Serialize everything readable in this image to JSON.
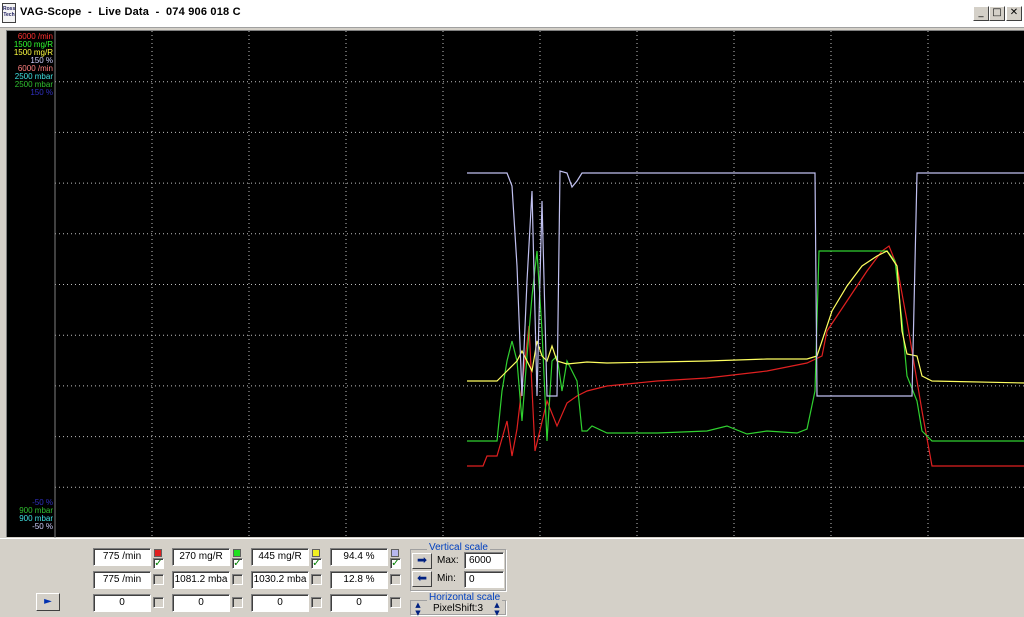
{
  "window": {
    "icon_text": "Ross Tech",
    "title": "VAG-Scope  -  Live Data  -  074 906 018 C",
    "minimize_glyph": "_",
    "maximize_glyph": "□",
    "close_glyph": "✕"
  },
  "scale_labels": {
    "top": [
      {
        "text": "6000 /min",
        "color": "#ff3030"
      },
      {
        "text": "1500 mg/R",
        "color": "#30ff30"
      },
      {
        "text": "1500 mg/R",
        "color": "#ffff40"
      },
      {
        "text": "150 %",
        "color": "#d0d0ff"
      },
      {
        "text": "6000 /min",
        "color": "#ff8080"
      },
      {
        "text": "2500 mbar",
        "color": "#40e0e0"
      },
      {
        "text": "2500 mbar",
        "color": "#30c030"
      },
      {
        "text": "150 %",
        "color": "#3030c0"
      }
    ],
    "bottom": [
      {
        "text": "-50 %",
        "color": "#3030c0"
      },
      {
        "text": "900 mbar",
        "color": "#30c030"
      },
      {
        "text": "900 mbar",
        "color": "#40e0e0"
      },
      {
        "text": "-50 %",
        "color": "#d0d0ff"
      }
    ]
  },
  "chart_data": {
    "type": "line",
    "title": "",
    "xlabel": "",
    "ylabel": "",
    "ylim": [
      0,
      6000
    ],
    "grid": true,
    "legend": "none",
    "x": [
      0,
      50,
      90,
      100,
      110,
      120,
      130,
      140,
      150,
      200,
      250,
      300,
      350,
      355,
      365,
      380,
      400,
      420,
      430,
      440,
      450,
      455,
      460,
      480,
      500,
      550
    ],
    "series": [
      {
        "name": "",
        "color": "#ff2020",
        "values": [
          0,
          0,
          0,
          0,
          0,
          0,
          0,
          0,
          0,
          0,
          0,
          0,
          0,
          0,
          0,
          0,
          0,
          0,
          0,
          0,
          0,
          0,
          0,
          0,
          0,
          0
        ]
      }
    ],
    "traces": [
      {
        "color": "#e02020",
        "values": [
          [
            460,
            435
          ],
          [
            476,
            435
          ],
          [
            480,
            425
          ],
          [
            490,
            425
          ],
          [
            500,
            390
          ],
          [
            505,
            425
          ],
          [
            510,
            398
          ],
          [
            515,
            355
          ],
          [
            522,
            295
          ],
          [
            528,
            420
          ],
          [
            540,
            370
          ],
          [
            550,
            395
          ],
          [
            560,
            372
          ],
          [
            570,
            365
          ],
          [
            580,
            360
          ],
          [
            600,
            355
          ],
          [
            650,
            350
          ],
          [
            700,
            347
          ],
          [
            760,
            340
          ],
          [
            800,
            332
          ],
          [
            815,
            325
          ],
          [
            820,
            300
          ],
          [
            840,
            270
          ],
          [
            860,
            240
          ],
          [
            875,
            220
          ],
          [
            882,
            215
          ],
          [
            890,
            235
          ],
          [
            900,
            290
          ],
          [
            915,
            380
          ],
          [
            925,
            435
          ],
          [
            1018,
            435
          ]
        ]
      },
      {
        "color": "#30d030",
        "values": [
          [
            460,
            410
          ],
          [
            490,
            410
          ],
          [
            495,
            360
          ],
          [
            500,
            330
          ],
          [
            505,
            310
          ],
          [
            510,
            330
          ],
          [
            515,
            390
          ],
          [
            520,
            325
          ],
          [
            525,
            265
          ],
          [
            530,
            220
          ],
          [
            535,
            300
          ],
          [
            540,
            410
          ],
          [
            545,
            330
          ],
          [
            550,
            325
          ],
          [
            555,
            360
          ],
          [
            560,
            330
          ],
          [
            570,
            350
          ],
          [
            575,
            400
          ],
          [
            580,
            400
          ],
          [
            585,
            395
          ],
          [
            600,
            402
          ],
          [
            650,
            402
          ],
          [
            700,
            400
          ],
          [
            720,
            395
          ],
          [
            740,
            403
          ],
          [
            760,
            400
          ],
          [
            790,
            402
          ],
          [
            800,
            398
          ],
          [
            808,
            360
          ],
          [
            812,
            220
          ],
          [
            880,
            220
          ],
          [
            888,
            230
          ],
          [
            895,
            290
          ],
          [
            900,
            345
          ],
          [
            910,
            370
          ],
          [
            915,
            400
          ],
          [
            925,
            410
          ],
          [
            1018,
            410
          ]
        ]
      },
      {
        "color": "#ffff60",
        "values": [
          [
            460,
            350
          ],
          [
            490,
            350
          ],
          [
            500,
            340
          ],
          [
            510,
            330
          ],
          [
            515,
            320
          ],
          [
            520,
            330
          ],
          [
            525,
            340
          ],
          [
            530,
            310
          ],
          [
            535,
            325
          ],
          [
            540,
            330
          ],
          [
            545,
            315
          ],
          [
            550,
            330
          ],
          [
            560,
            333
          ],
          [
            580,
            331
          ],
          [
            600,
            332
          ],
          [
            650,
            331
          ],
          [
            700,
            330
          ],
          [
            760,
            328
          ],
          [
            800,
            328
          ],
          [
            810,
            325
          ],
          [
            815,
            310
          ],
          [
            825,
            280
          ],
          [
            840,
            255
          ],
          [
            855,
            235
          ],
          [
            870,
            225
          ],
          [
            880,
            220
          ],
          [
            890,
            235
          ],
          [
            895,
            300
          ],
          [
            900,
            323
          ],
          [
            910,
            325
          ],
          [
            915,
            345
          ],
          [
            925,
            350
          ],
          [
            1018,
            352
          ]
        ]
      },
      {
        "color": "#c0c0f0",
        "values": [
          [
            460,
            142
          ],
          [
            500,
            142
          ],
          [
            505,
            155
          ],
          [
            510,
            235
          ],
          [
            515,
            365
          ],
          [
            520,
            250
          ],
          [
            525,
            160
          ],
          [
            530,
            365
          ],
          [
            535,
            170
          ],
          [
            540,
            365
          ],
          [
            545,
            365
          ],
          [
            550,
            365
          ],
          [
            553,
            140
          ],
          [
            560,
            142
          ],
          [
            565,
            156
          ],
          [
            570,
            150
          ],
          [
            575,
            142
          ],
          [
            808,
            142
          ],
          [
            810,
            365
          ],
          [
            905,
            365
          ],
          [
            910,
            142
          ],
          [
            1018,
            142
          ]
        ]
      }
    ]
  },
  "channels": [
    {
      "value": "775 /min",
      "swatch": "#e02020",
      "checked": true
    },
    {
      "value": "270 mg/R",
      "swatch": "#20e020",
      "checked": true
    },
    {
      "value": "445 mg/R",
      "swatch": "#f0f020",
      "checked": true
    },
    {
      "value": "94.4 %",
      "swatch": "#b8b8f0",
      "checked": true
    },
    {
      "value": "775 /min",
      "swatch": "",
      "checked": false
    },
    {
      "value": "1081.2 mba",
      "swatch": "",
      "checked": false
    },
    {
      "value": "1030.2 mba",
      "swatch": "",
      "checked": false
    },
    {
      "value": "12.8 %",
      "swatch": "",
      "checked": false
    },
    {
      "value": "0",
      "swatch": "",
      "checked": false
    },
    {
      "value": "0",
      "swatch": "",
      "checked": false
    },
    {
      "value": "0",
      "swatch": "",
      "checked": false
    },
    {
      "value": "0",
      "swatch": "",
      "checked": false
    }
  ],
  "vertical_scale": {
    "label": "Vertical scale",
    "max_label": "Max:",
    "max_value": "6000",
    "min_label": "Min:",
    "min_value": "0",
    "arrow_right": "➡",
    "arrow_left": "⬅"
  },
  "horizontal_scale": {
    "label": "Horizontal scale",
    "value": "PixelShift:3"
  },
  "play_glyph": "►"
}
